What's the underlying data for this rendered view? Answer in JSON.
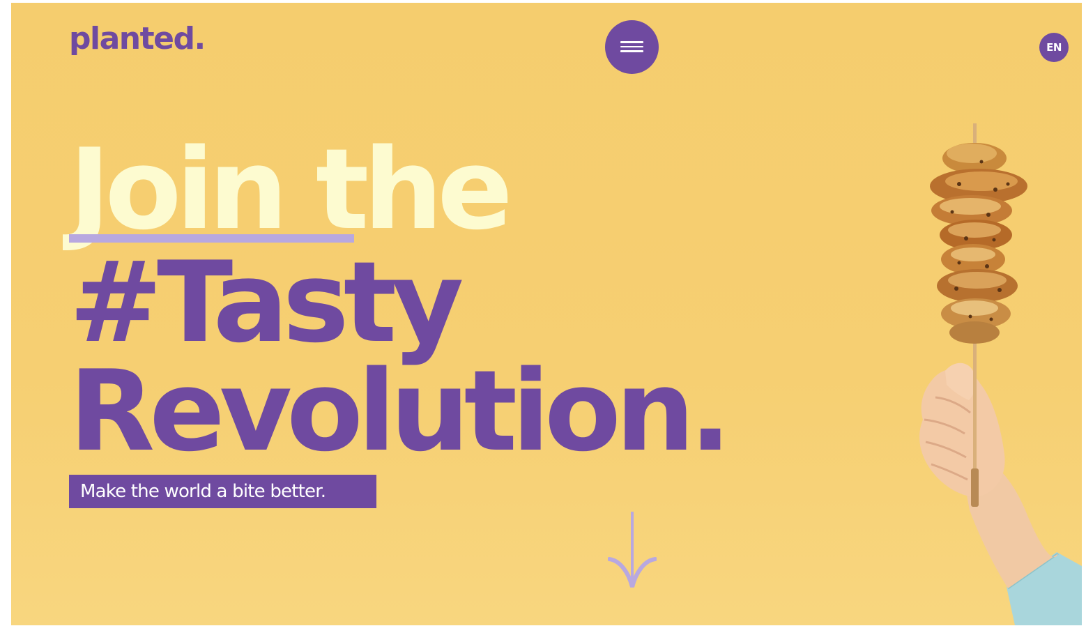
{
  "header": {
    "logo_text": "planted.",
    "menu_icon": "hamburger-menu-icon",
    "language_label": "EN"
  },
  "hero": {
    "line1_word1": "Join",
    "line1_word2": "the",
    "line2": "#Tasty",
    "line3": "Revolution.",
    "tagline": "Make the world a bite better."
  },
  "scroll_icon": "arrow-down-icon",
  "image": {
    "description_icon": "skewer-in-hand-image"
  },
  "colors": {
    "background": "#f6cf72",
    "brand_purple": "#6f4aa0",
    "highlight_cream": "#fdfbd0",
    "underline_lavender": "#b8a8e0",
    "arrow_lavender": "#b8a8e0"
  }
}
